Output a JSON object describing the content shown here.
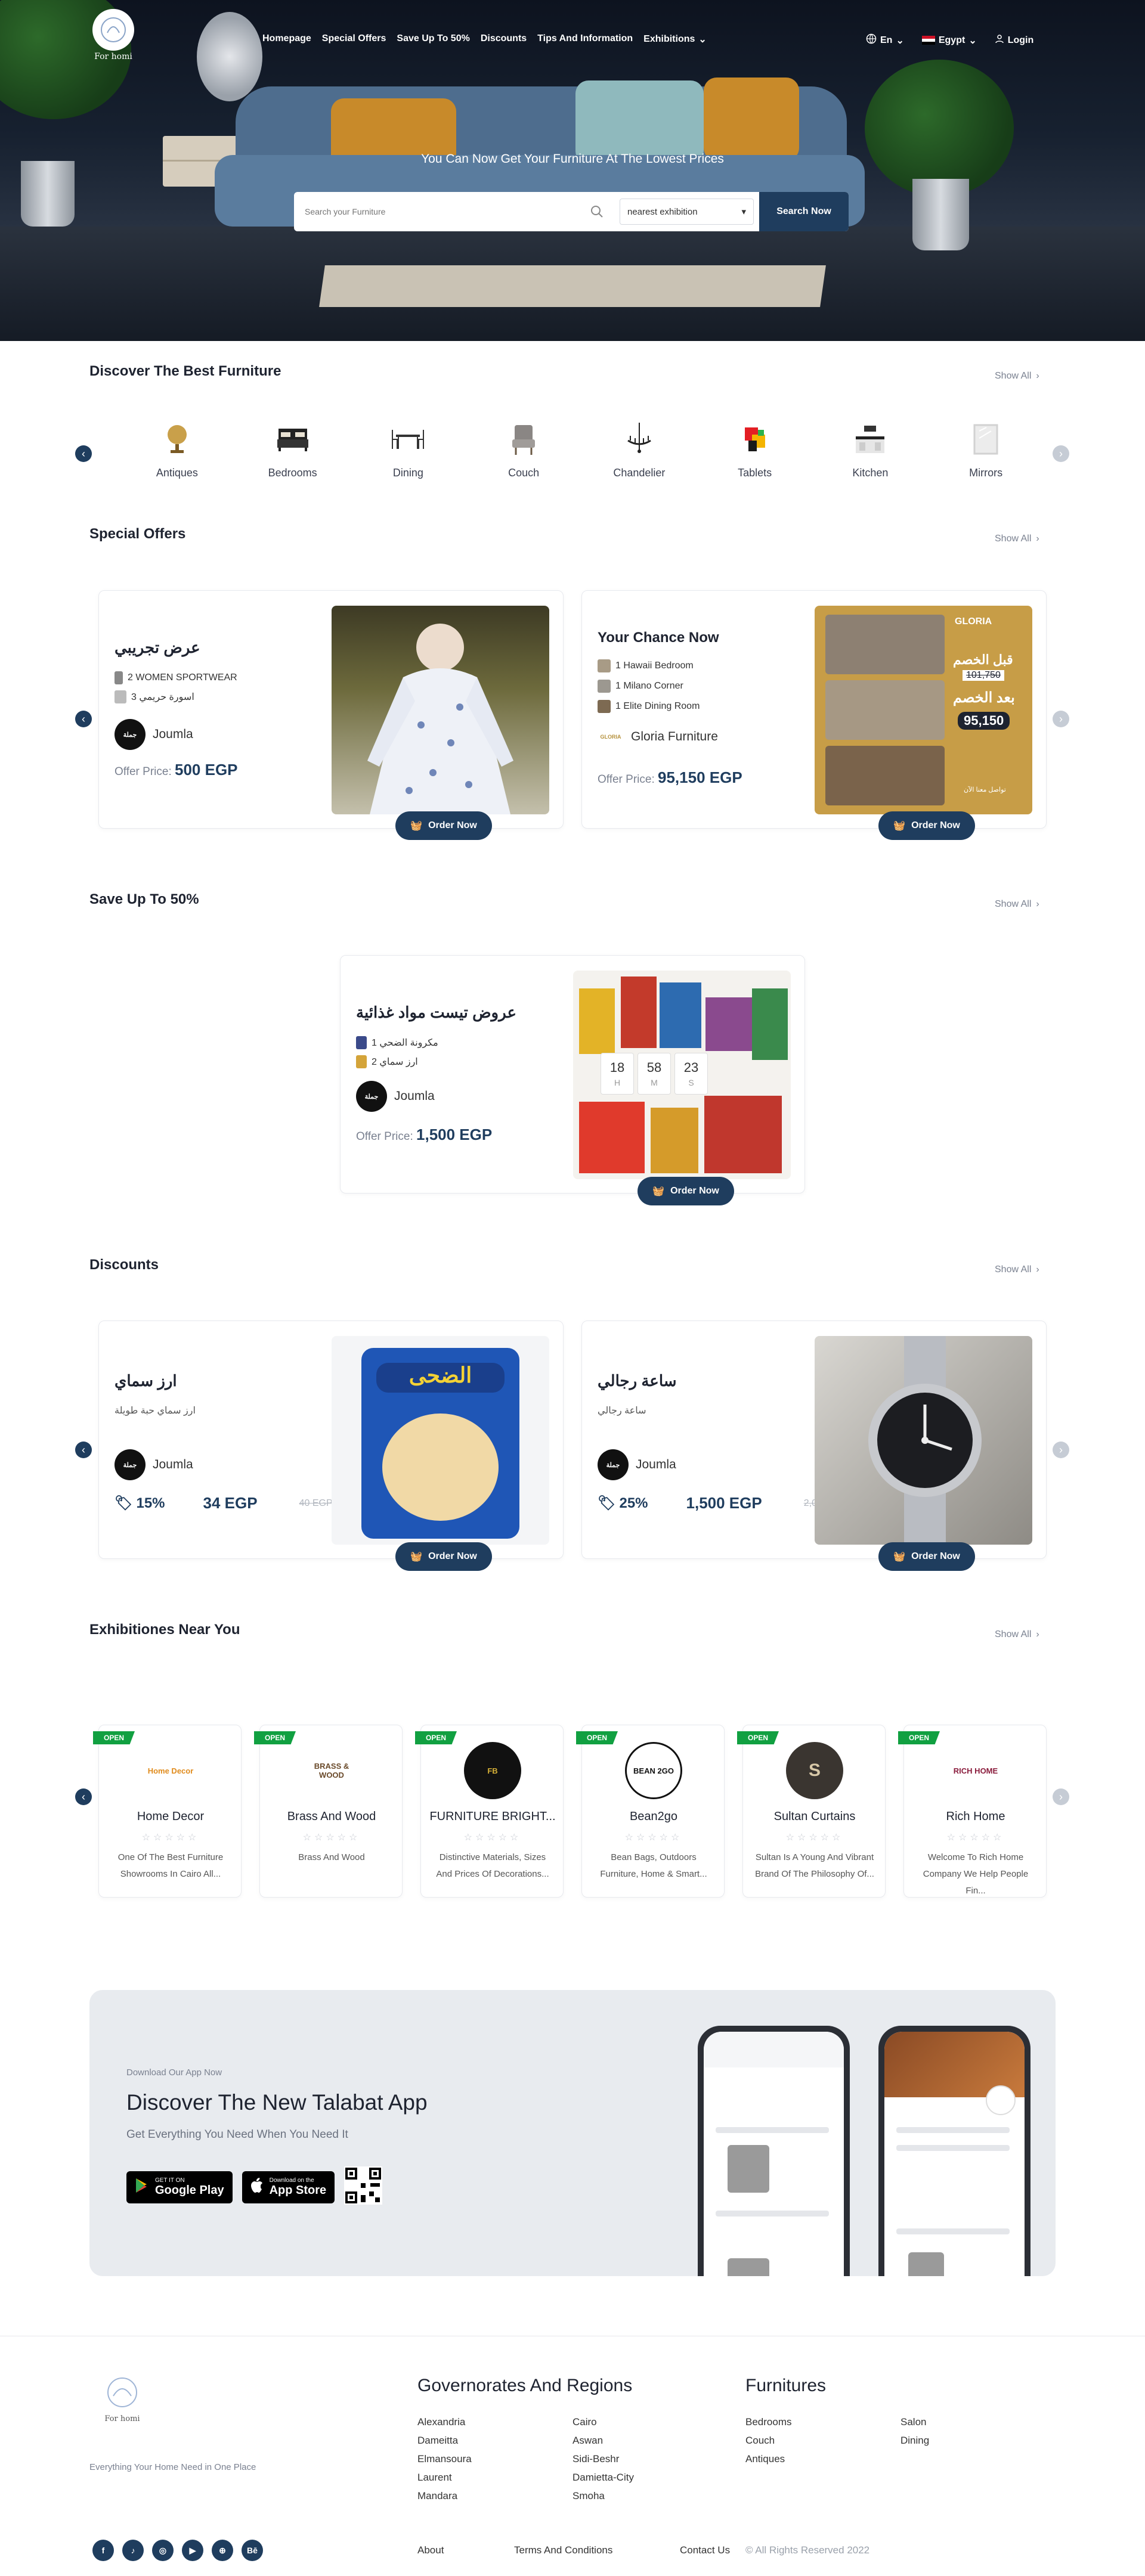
{
  "nav": {
    "logo_text": "For homi",
    "items": [
      "Homepage",
      "Special Offers",
      "Save Up To 50%",
      "Discounts",
      "Tips And Information",
      "Exhibitions"
    ],
    "language": "En",
    "country": "Egypt",
    "login": "Login"
  },
  "hero": {
    "title": "You Can Now Get Your Furniture At The Lowest Prices",
    "search_placeholder": "Search your Furniture",
    "select_value": "nearest exhibition",
    "search_button": "Search Now"
  },
  "categories": {
    "title": "Discover The Best Furniture",
    "show_all": "Show All",
    "items": [
      "Antiques",
      "Bedrooms",
      "Dining",
      "Couch",
      "Chandelier",
      "Tablets",
      "Kitchen",
      "Mirrors"
    ]
  },
  "special_offers": {
    "title": "Special Offers",
    "show_all": "Show All",
    "offer_label": "Offer Price:",
    "order_button": "Order Now",
    "cards": [
      {
        "title": "عرض تجريبي",
        "lines": [
          "2 WOMEN SPORTWEAR",
          "3 اسورة حريمي"
        ],
        "vendor": "Joumla",
        "price": "500 EGP"
      },
      {
        "title": "Your Chance Now",
        "lines": [
          "1 Hawaii Bedroom",
          "1 Milano Corner",
          "1 Elite Dining Room"
        ],
        "vendor": "Gloria Furniture",
        "price": "95,150 EGP",
        "poster": {
          "brand": "GLORIA",
          "before": "قبل الخصم",
          "old": "101,750",
          "after": "بعد الخصم",
          "new": "95,150",
          "cta": "تواصل معنا الآن"
        }
      }
    ]
  },
  "save_up": {
    "title": "Save Up To 50%",
    "show_all": "Show All",
    "card": {
      "title": "عروض تيست مواد غذائية",
      "lines": [
        "1 مكرونة الضحي",
        "2 ارز سماي"
      ],
      "vendor": "Joumla",
      "offer_label": "Offer Price:",
      "price": "1,500 EGP",
      "timer": [
        {
          "value": "18",
          "unit": "H"
        },
        {
          "value": "58",
          "unit": "M"
        },
        {
          "value": "23",
          "unit": "S"
        }
      ],
      "order_button": "Order Now"
    }
  },
  "discounts": {
    "title": "Discounts",
    "show_all": "Show All",
    "order_button": "Order Now",
    "cards": [
      {
        "title": "ارز سماي",
        "subtitle": "ارز سماي حبة طويلة",
        "vendor": "Joumla",
        "percent": "15%",
        "price": "34 EGP",
        "old_price": "40 EGP",
        "product_label": "الضحى"
      },
      {
        "title": "ساعة رجالي",
        "subtitle": "ساعة رجالي",
        "vendor": "Joumla",
        "percent": "25%",
        "price": "1,500 EGP",
        "old_price": "2,000 EGP"
      }
    ]
  },
  "exhibitions": {
    "title": "Exhibitiones Near You",
    "show_all": "Show All",
    "open_label": "OPEN",
    "items": [
      {
        "name": "Home Decor",
        "desc": "One Of The Best Furniture Showrooms In Cairo All...",
        "logo": "Home Decor"
      },
      {
        "name": "Brass And Wood",
        "desc": "Brass And Wood",
        "logo": "BRASS & WOOD"
      },
      {
        "name": "FURNITURE BRIGHT...",
        "desc": "Distinctive Materials, Sizes And Prices Of Decorations...",
        "logo": "FB"
      },
      {
        "name": "Bean2go",
        "desc": "Bean Bags, Outdoors Furniture, Home & Smart...",
        "logo": "BEAN 2GO"
      },
      {
        "name": "Sultan Curtains",
        "desc": "Sultan Is A Young And Vibrant Brand Of The Philosophy Of...",
        "logo": "S"
      },
      {
        "name": "Rich Home",
        "desc": "Welcome To Rich Home Company We Help People Fin...",
        "logo": "RICH HOME"
      }
    ]
  },
  "app": {
    "kicker": "Download Our App Now",
    "title": "Discover The New Talabat App",
    "subtitle": "Get Everything You Need When You Need It",
    "google_small": "GET IT ON",
    "google_big": "Google Play",
    "apple_small": "Download on the",
    "apple_big": "App Store"
  },
  "footer": {
    "logo_text": "For homi",
    "tagline": "Everything Your Home Need in One Place",
    "regions_title": "Governorates And Regions",
    "regions_col1": [
      "Alexandria",
      "Dameitta",
      "Elmansoura",
      "Laurent",
      "Mandara"
    ],
    "regions_col2": [
      "Cairo",
      "Aswan",
      "Sidi-Beshr",
      "Damietta-City",
      "Smoha"
    ],
    "furn_title": "Furnitures",
    "furn_col1": [
      "Bedrooms",
      "Couch",
      "Antiques"
    ],
    "furn_col2": [
      "Salon",
      "Dining"
    ],
    "links": [
      "About",
      "Terms And Conditions",
      "Contact Us"
    ],
    "copyright": "© All Rights Reserved 2022"
  },
  "colors": {
    "primary": "#1f3d5e",
    "open_badge": "#11a041",
    "app_bg": "#e8ebef"
  }
}
